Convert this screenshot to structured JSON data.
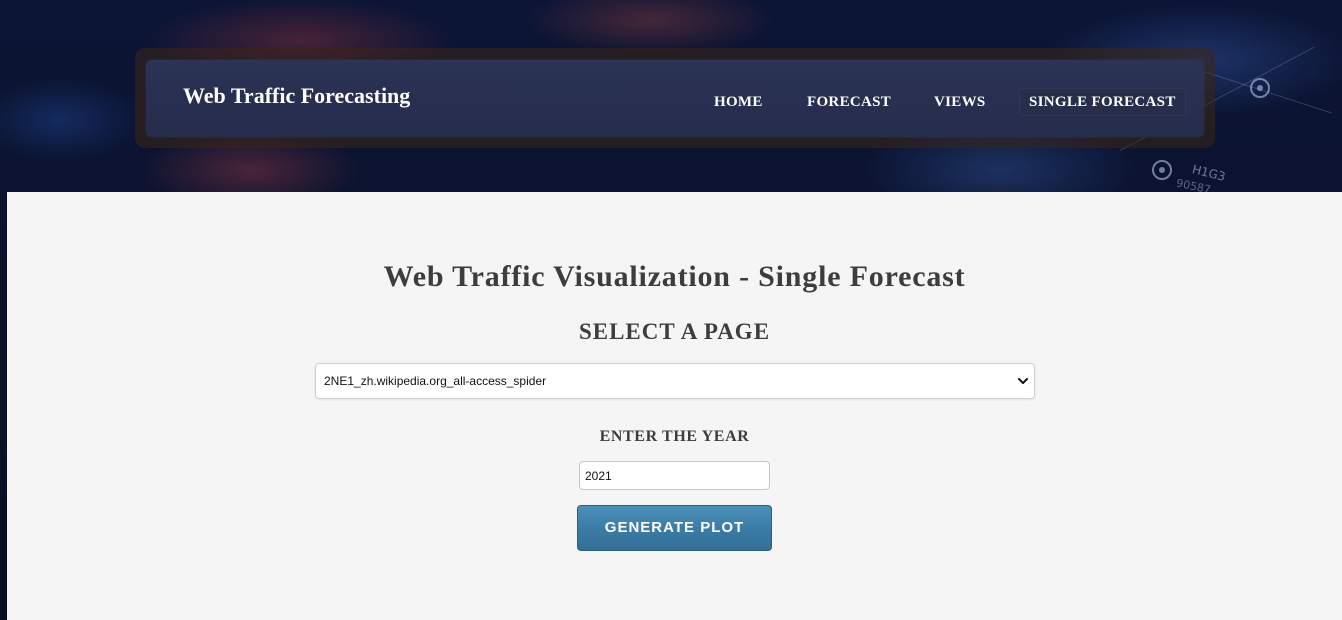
{
  "navbar": {
    "brand": "Web Traffic Forecasting",
    "links": [
      {
        "label": "HOME",
        "active": false
      },
      {
        "label": "FORECAST",
        "active": false
      },
      {
        "label": "VIEWS",
        "active": false
      },
      {
        "label": "SINGLE FORECAST",
        "active": true
      }
    ]
  },
  "background": {
    "overlay_text": "H1G3",
    "overlay_number": "90587"
  },
  "main": {
    "title": "Web Traffic Visualization - Single Forecast",
    "select_label": "SELECT A PAGE",
    "page_select": {
      "selected": "2NE1_zh.wikipedia.org_all-access_spider"
    },
    "year_label": "ENTER THE YEAR",
    "year_input": {
      "value": "2021"
    },
    "generate_button": "GENERATE PLOT"
  },
  "colors": {
    "panel_bg": "#f5f5f5",
    "navbar_bg": "#2b3356",
    "button_bg": "#3a7ba4",
    "text_dark": "#3d3d3d"
  },
  "icons": {
    "select_chevron": "chevron-down-icon",
    "bg_target_1": "target-circle-icon",
    "bg_target_2": "target-circle-icon"
  }
}
